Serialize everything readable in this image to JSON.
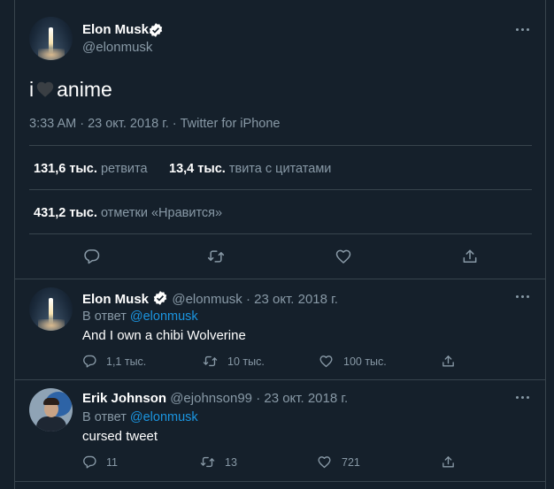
{
  "main_tweet": {
    "author_name": "Elon Musk",
    "handle": "@elonmusk",
    "text_before": "i",
    "text_after": "anime",
    "meta": "3:33 AM · 23 окт. 2018 г. · Twitter for iPhone",
    "retweets_count": "131,6 тыс.",
    "retweets_label": "ретвита",
    "quotes_count": "13,4 тыс.",
    "quotes_label": "твита с цитатами",
    "likes_count": "431,2 тыс.",
    "likes_label": "отметки «Нравится»"
  },
  "replies": [
    {
      "author_name": "Elon Musk",
      "handle": "@elonmusk",
      "sep": "·",
      "date": "23 окт. 2018 г.",
      "reply_prefix": "В ответ",
      "reply_to": "@elonmusk",
      "text": "And I own a chibi Wolverine",
      "replies": "1,1 тыс.",
      "retweets": "10 тыс.",
      "likes": "100 тыс."
    },
    {
      "author_name": "Erik Johnson",
      "handle": "@ejohnson99",
      "sep": "·",
      "date": "23 окт. 2018 г.",
      "reply_prefix": "В ответ",
      "reply_to": "@elonmusk",
      "text": "cursed tweet",
      "replies": "11",
      "retweets": "13",
      "likes": "721"
    }
  ],
  "colors": {
    "background": "#15202b",
    "border": "#38444d",
    "secondary_text": "#8899a6",
    "link": "#1b95e0"
  },
  "icons": {
    "reply": "reply-icon",
    "retweet": "retweet-icon",
    "like": "heart-icon",
    "share": "share-icon",
    "verified": "verified-badge-icon",
    "heart_emoji": "black-heart-icon"
  }
}
